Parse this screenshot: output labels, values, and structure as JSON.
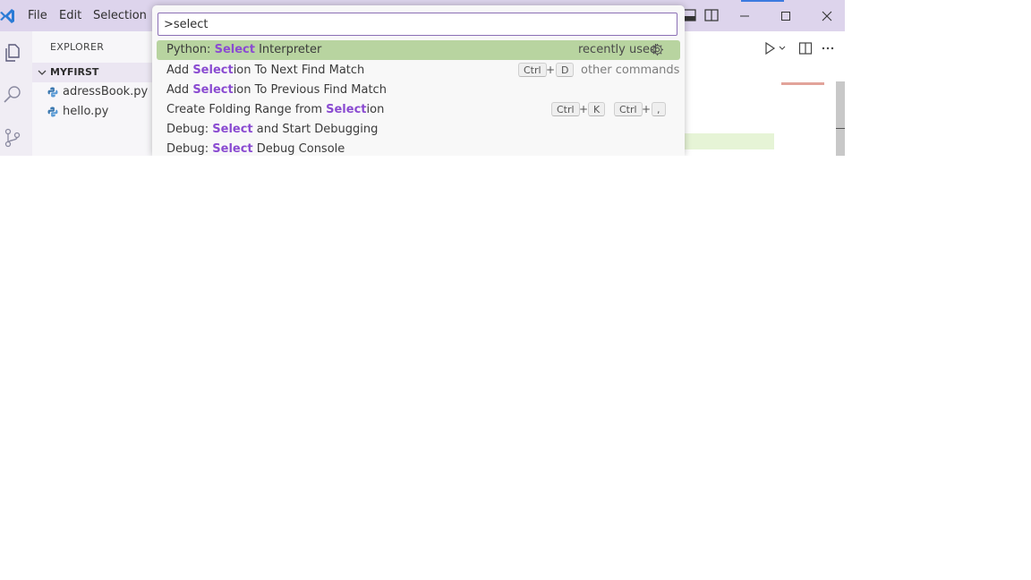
{
  "titlebar": {
    "menu": [
      "File",
      "Edit",
      "Selection"
    ]
  },
  "sidebar": {
    "title": "EXPLORER",
    "folder": "MYFIRST",
    "files": [
      "adressBook.py",
      "hello.py"
    ]
  },
  "palette": {
    "input_value": ">select",
    "items": [
      {
        "prefix": "Python: ",
        "match": "Select",
        "suffix": " Interpreter",
        "detail": "recently used",
        "selected": true
      },
      {
        "prefix": "Add ",
        "match": "Select",
        "suffix": "ion To Next Find Match",
        "keys": [
          "Ctrl",
          "D"
        ],
        "detail": "other commands"
      },
      {
        "prefix": "Add ",
        "match": "Select",
        "suffix": "ion To Previous Find Match"
      },
      {
        "prefix": "Create Folding Range from ",
        "match": "Select",
        "suffix": "ion",
        "chord1": [
          "Ctrl",
          "K"
        ],
        "chord2": [
          "Ctrl",
          ","
        ]
      },
      {
        "prefix": "Debug: ",
        "match": "Select",
        "suffix": " and Start Debugging"
      },
      {
        "prefix": "Debug: ",
        "match": "Select",
        "suffix": " Debug Console"
      }
    ],
    "plus": "+"
  },
  "icons": [
    "vscode-logo-icon",
    "explorer-icon",
    "search-icon",
    "source-control-icon",
    "python-file-icon",
    "gear-icon",
    "run-icon",
    "split-editor-icon",
    "more-actions-icon",
    "minimize-icon",
    "maximize-icon",
    "close-icon"
  ],
  "colors": {
    "titlebar": "#ddd4ec",
    "selected_row": "#b8d4a0",
    "match_highlight": "#8a4bd1",
    "input_border": "#8b6fb5"
  }
}
